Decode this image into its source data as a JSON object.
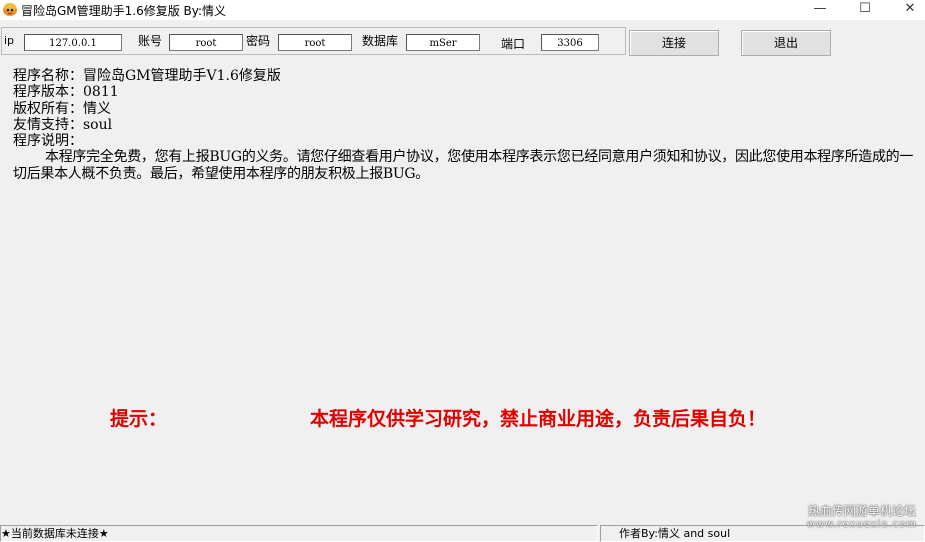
{
  "window": {
    "title": "冒险岛GM管理助手1.6修复版 By:情义",
    "minimize": "—",
    "maximize": "☐",
    "close": "✕"
  },
  "connection": {
    "ip_label": "ip",
    "ip_value": "127.0.0.1",
    "account_label": "账号",
    "account_value": "root",
    "password_label": "密码",
    "password_value": "root",
    "database_label": "数据库",
    "database_value": "mSer",
    "port_label": "端口",
    "port_value": "3306",
    "connect_button": "连接",
    "exit_button": "退出"
  },
  "info": {
    "name": "程序名称：冒险岛GM管理助手V1.6修复版",
    "version": "程序版本：0811",
    "copyright": "版权所有：情义",
    "support": "友情支持：soul",
    "description_label": "程序说明：",
    "description": "本程序完全免费，您有上报BUG的义务。请您仔细查看用户协议，您使用本程序表示您已经同意用户须知和协议，因此您使用本程序所造成的一切后果本人概不负责。最后，希望使用本程序的朋友积极上报BUG。"
  },
  "notice": {
    "label": "提示：",
    "text": "本程序仅供学习研究，禁止商业用途，负责后果自负！"
  },
  "statusbar": {
    "db_status": "★当前数据库未连接★",
    "author": "作者By:情义 and soul"
  },
  "watermark": {
    "site_name": "热血传网游单机论坛",
    "url": "www.rexuexia.com"
  },
  "colors": {
    "notice": "#e00000",
    "background": "#f0f0f0"
  }
}
